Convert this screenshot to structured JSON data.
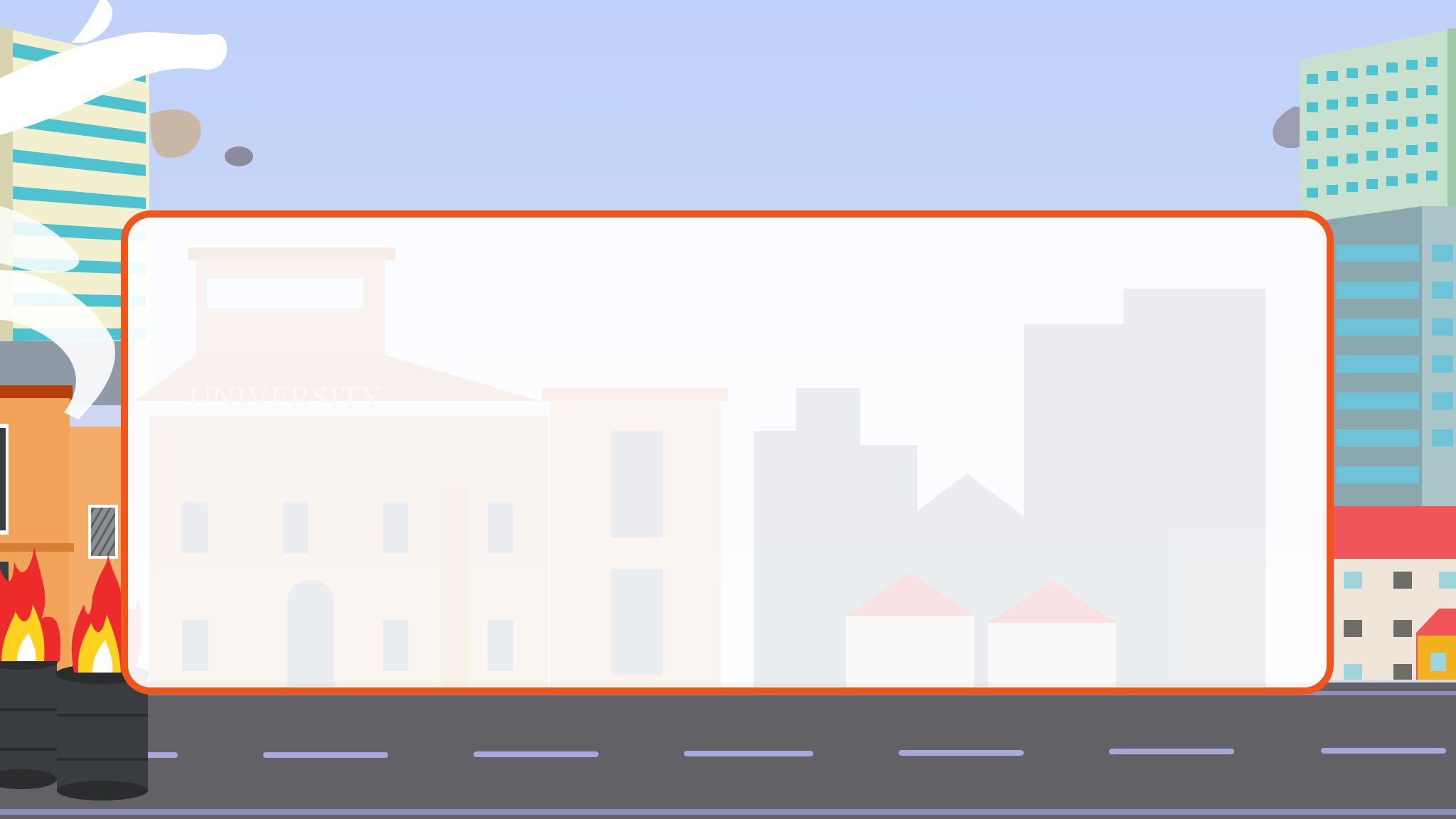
{
  "scene": {
    "description_free": true,
    "colors": {
      "sky_top": "#bfd2fb",
      "sky_bottom": "#d3d8ef",
      "road": "#616166",
      "road_marking": "#a7a9de",
      "panel_border": "#f0561b",
      "panel_fill": "#ffffff",
      "building_teal": "#4fc2cf",
      "building_cream": "#f2f0cf",
      "building_orange": "#f2a35a",
      "roof_red": "#f0555a",
      "fire_red": "#ee2b2b",
      "fire_yellow": "#ffd21f",
      "barrel": "#3a3d3f"
    },
    "icons": [
      "fire-icon",
      "smoke-icon",
      "barrel-icon"
    ]
  },
  "panel": {
    "background_sign_text": "UNIVERSITY"
  }
}
